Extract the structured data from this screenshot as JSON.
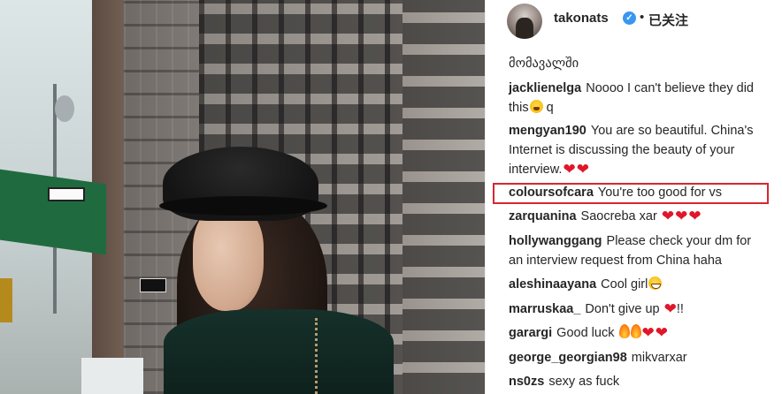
{
  "photo": {
    "alt": "woman in black cap on city street"
  },
  "post": {
    "username": "takonats",
    "verified": true,
    "separator": "•",
    "follow_state": "已关注"
  },
  "comments": [
    {
      "user": "",
      "text": "მომავალში",
      "emojis": []
    },
    {
      "user": "jacklienelga",
      "text": "Noooo I can't believe they did",
      "text2": "this",
      "emojis": [
        "tired"
      ],
      "text3": "q"
    },
    {
      "user": "mengyan190",
      "text": "You are so beautiful. China's",
      "text2": "Internet is discussing the beauty of your",
      "text3": "interview.",
      "emojis": [
        "heart",
        "heart"
      ]
    },
    {
      "user": "coloursofcara",
      "text": "You're too good for vs",
      "highlighted": true
    },
    {
      "user": "zarquanina",
      "text": "Saocreba xar",
      "emojis": [
        "heart",
        "heart",
        "heart"
      ]
    },
    {
      "user": "hollywanggang",
      "text": "Please check your dm for",
      "text2": "an interview request from China haha"
    },
    {
      "user": "aleshinaayana",
      "text": "Cool girl",
      "emojis": [
        "grin"
      ]
    },
    {
      "user": "marruskaa_",
      "text": "Don't give up",
      "emojis": [
        "heart"
      ],
      "suffix": "!!"
    },
    {
      "user": "garargi",
      "text": "Good luck",
      "emojis": [
        "fire",
        "fire",
        "heart",
        "heart"
      ]
    },
    {
      "user": "george_georgian98",
      "text": "mikvarxar"
    },
    {
      "user": "ns0zs",
      "text": "sexy as fuck"
    }
  ],
  "colors": {
    "highlight": "#d8262f",
    "verified": "#3897f0",
    "heart": "#e0162b"
  }
}
